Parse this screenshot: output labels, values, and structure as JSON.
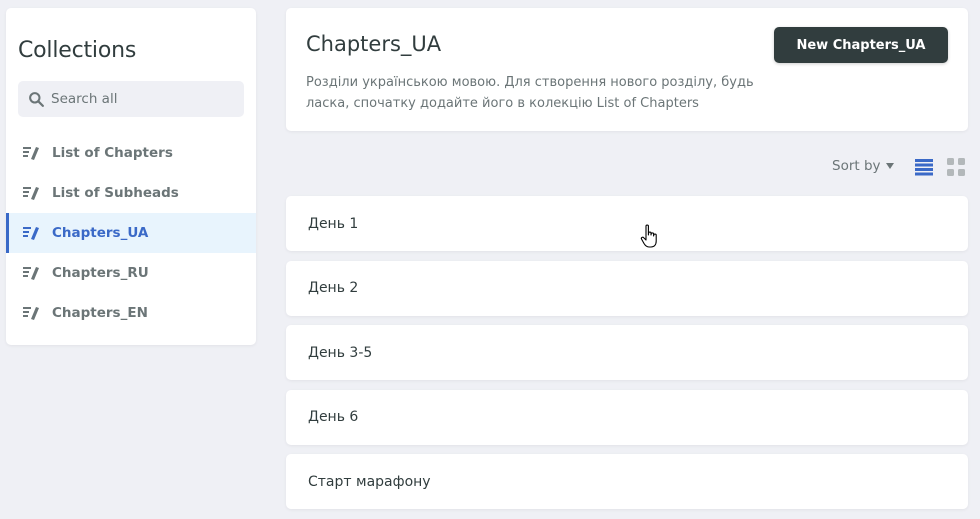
{
  "sidebar": {
    "title": "Collections",
    "search_placeholder": "Search all",
    "items": [
      {
        "label": "List of Chapters",
        "icon": "collection-edit-icon"
      },
      {
        "label": "List of Subheads",
        "icon": "collection-edit-icon"
      },
      {
        "label": "Chapters_UA",
        "icon": "collection-edit-icon",
        "active": true
      },
      {
        "label": "Chapters_RU",
        "icon": "collection-edit-icon"
      },
      {
        "label": "Chapters_EN",
        "icon": "collection-edit-icon"
      }
    ]
  },
  "header": {
    "title": "Chapters_UA",
    "description": "Розділи українською мовою. Для створення нового розділу, будь ласка, спочатку додайте його в колекцію List of Chapters",
    "new_button": "New Chapters_UA"
  },
  "toolbar": {
    "sort_label": "Sort by",
    "view_mode": "list"
  },
  "entries": [
    {
      "title": "День 1"
    },
    {
      "title": "День 2"
    },
    {
      "title": "День 3-5"
    },
    {
      "title": "День 6"
    },
    {
      "title": "Старт марафону"
    }
  ],
  "colors": {
    "background": "#eff0f5",
    "text_dark": "#313d3e",
    "text_muted": "#6b7577",
    "accent": "#3a69c7",
    "active_bg": "#e8f4fd"
  }
}
